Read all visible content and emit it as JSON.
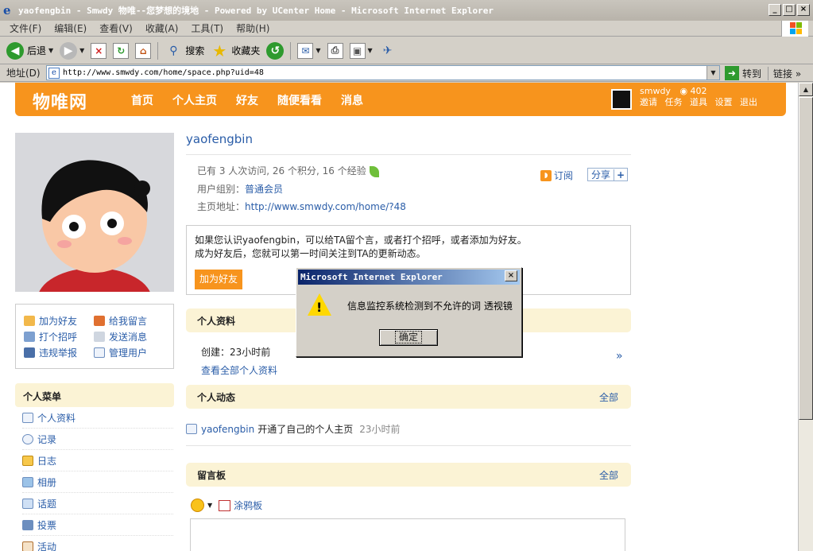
{
  "window": {
    "title": "yaofengbin - Smwdy 物唯--您梦想的境地 - Powered by UCenter Home - Microsoft Internet Explorer"
  },
  "menubar": [
    "文件(F)",
    "编辑(E)",
    "查看(V)",
    "收藏(A)",
    "工具(T)",
    "帮助(H)"
  ],
  "toolbar": {
    "back": "后退",
    "search": "搜索",
    "favorites": "收藏夹"
  },
  "address": {
    "label": "地址(D)",
    "url": "http://www.smwdy.com/home/space.php?uid=48",
    "go": "转到",
    "links": "链接"
  },
  "site": {
    "logo": "物唯网",
    "nav": [
      "首页",
      "个人主页",
      "好友",
      "随便看看",
      "消息"
    ],
    "user": "smwdy",
    "credits": "402",
    "user_links": [
      "邀请",
      "任务",
      "道具",
      "设置",
      "退出"
    ]
  },
  "actions": {
    "add_friend": "加为好友",
    "leave_message": "给我留言",
    "greet": "打个招呼",
    "send_message": "发送消息",
    "report": "违规举报",
    "manage_user": "管理用户"
  },
  "personal_menu": {
    "title": "个人菜单",
    "items": [
      "个人资料",
      "记录",
      "日志",
      "相册",
      "话题",
      "投票",
      "活动"
    ]
  },
  "profile": {
    "username": "yaofengbin",
    "stats": "已有 3 人次访问, 26 个积分, 16 个经验",
    "group_label": "用户组别：",
    "group": "普通会员",
    "home_label": "主页地址：",
    "home_url": "http://www.smwdy.com/home/?48",
    "subscribe": "订阅",
    "share": "分享",
    "share_plus": "+"
  },
  "friend_box": {
    "line1": "如果您认识yaofengbin，可以给TA留个言，或者打个招呼，或者添加为好友。",
    "line2": "成为好友后，您就可以第一时间关注到TA的更新动态。",
    "button": "加为好友"
  },
  "sections": {
    "profile_title": "个人资料",
    "created": "创建：23小时前",
    "view_all": "查看全部个人资料",
    "raquo": "»",
    "feed_title": "个人动态",
    "feed_more": "全部",
    "feed_user": "yaofengbin",
    "feed_text": "开通了自己的个人主页",
    "feed_time": "23小时前",
    "board_title": "留言板",
    "board_more": "全部",
    "graffiti": "涂鸦板"
  },
  "dialog": {
    "title": "Microsoft Internet Explorer",
    "message": "信息监控系统检测到不允许的词 透视镜",
    "ok": "确定"
  },
  "colors": {
    "brand_orange": "#f7941d",
    "link_blue": "#2a5da8",
    "section_bg": "#fbf3d5"
  }
}
